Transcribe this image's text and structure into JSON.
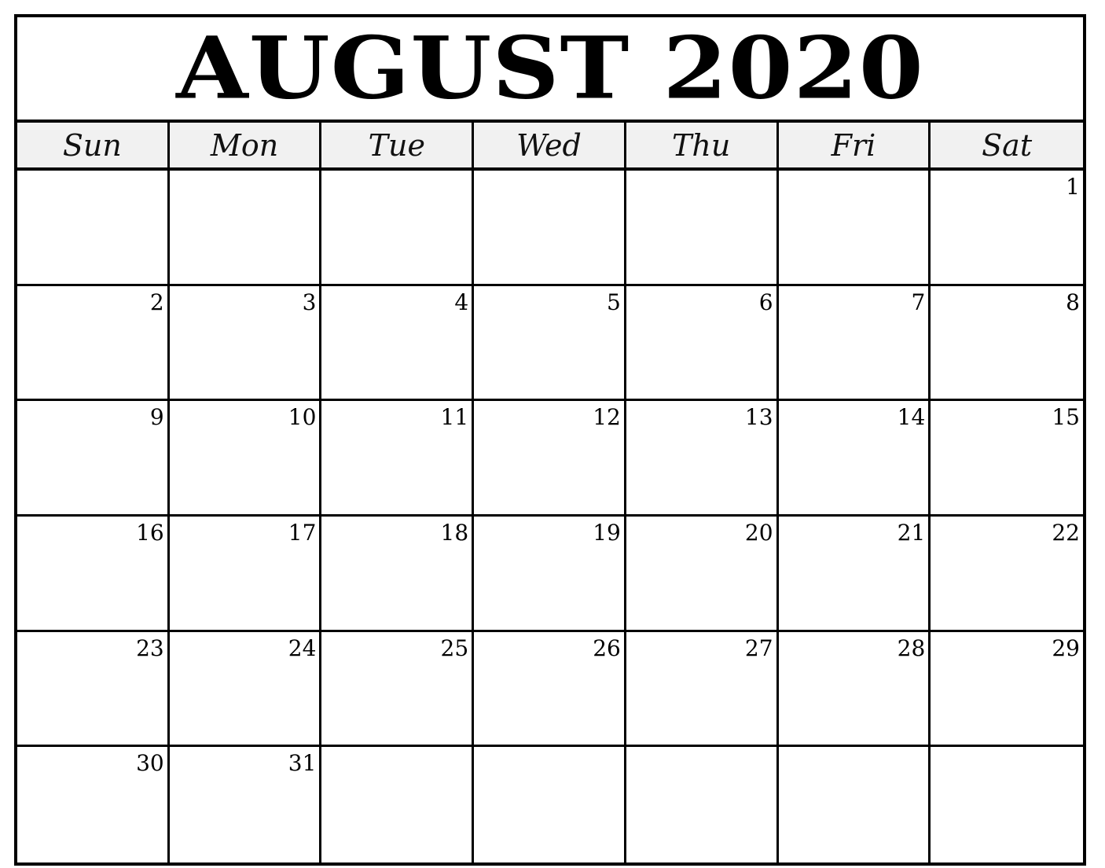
{
  "title": "AUGUST 2020",
  "weekdays": [
    "Sun",
    "Mon",
    "Tue",
    "Wed",
    "Thu",
    "Fri",
    "Sat"
  ],
  "weeks": [
    [
      "",
      "",
      "",
      "",
      "",
      "",
      "1"
    ],
    [
      "2",
      "3",
      "4",
      "5",
      "6",
      "7",
      "8"
    ],
    [
      "9",
      "10",
      "11",
      "12",
      "13",
      "14",
      "15"
    ],
    [
      "16",
      "17",
      "18",
      "19",
      "20",
      "21",
      "22"
    ],
    [
      "23",
      "24",
      "25",
      "26",
      "27",
      "28",
      "29"
    ],
    [
      "30",
      "31",
      "",
      "",
      "",
      "",
      ""
    ]
  ],
  "colors": {
    "header_bg": "#f1f1f1",
    "border": "#000000"
  }
}
